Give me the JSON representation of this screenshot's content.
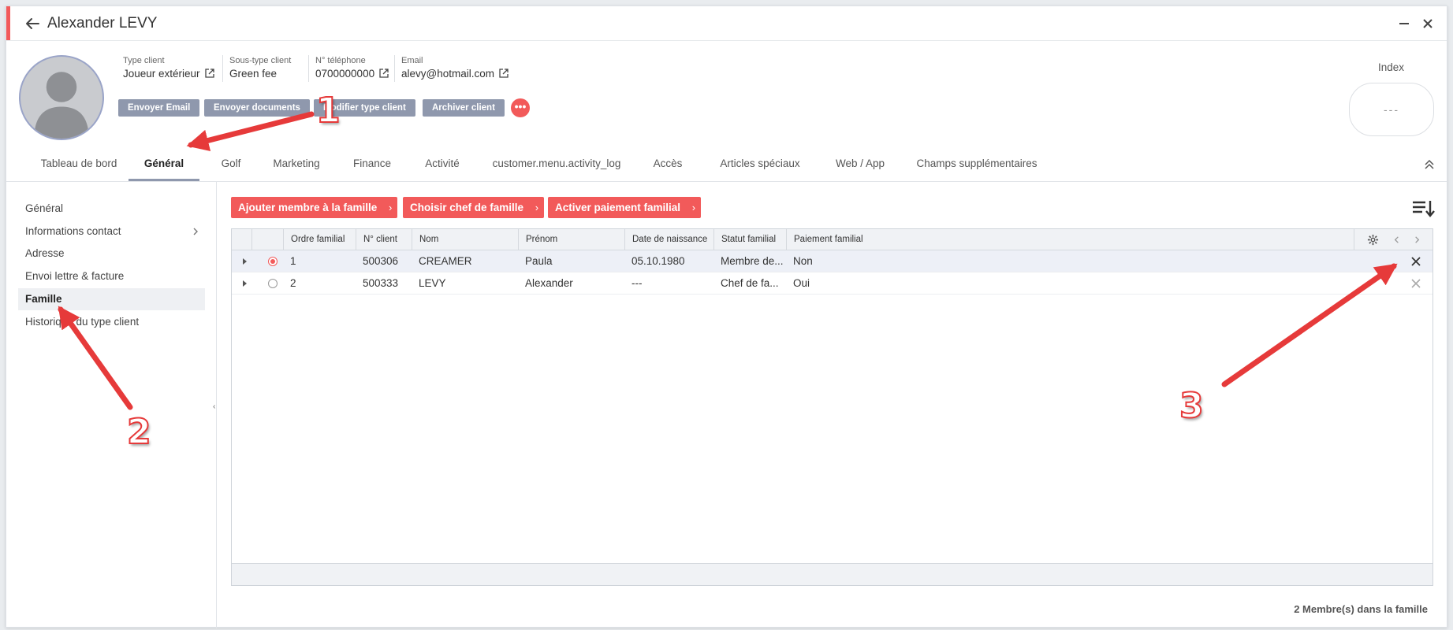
{
  "window": {
    "title": "Alexander LEVY"
  },
  "client_info": [
    {
      "label": "Type client",
      "value": "Joueur extérieur",
      "ext": true
    },
    {
      "label": "Sous-type client",
      "value": "Green fee",
      "ext": false
    },
    {
      "label": "N° téléphone",
      "value": "0700000000",
      "ext": true
    },
    {
      "label": "Email",
      "value": "alevy@hotmail.com",
      "ext": true
    }
  ],
  "actions": [
    "Envoyer Email",
    "Envoyer documents",
    "Modifier type client",
    "Archiver client"
  ],
  "more_label": "•••",
  "index": {
    "label": "Index",
    "value": "---"
  },
  "tabs": [
    "Tableau de bord",
    "Général",
    "Golf",
    "Marketing",
    "Finance",
    "Activité",
    "customer.menu.activity_log",
    "Accès",
    "Articles spéciaux",
    "Web / App",
    "Champs supplémentaires"
  ],
  "active_tab": "Général",
  "sidebar": [
    "Général",
    "Informations contact",
    "Adresse",
    "Envoi lettre & facture",
    "Famille",
    "Historique du type client"
  ],
  "active_sidebar": "Famille",
  "family_actions": [
    "Ajouter membre à la famille",
    "Choisir chef de famille",
    "Activer paiement familial"
  ],
  "grid": {
    "columns": [
      "Ordre familial",
      "N° client",
      "Nom",
      "Prénom",
      "Date de naissance",
      "Statut familial",
      "Paiement familial"
    ],
    "rows": [
      {
        "ordre": "1",
        "num": "500306",
        "nom": "CREAMER",
        "prenom": "Paula",
        "naissance": "05.10.1980",
        "statut": "Membre de...",
        "paiement": "Non",
        "selected": true
      },
      {
        "ordre": "2",
        "num": "500333",
        "nom": "LEVY",
        "prenom": "Alexander",
        "naissance": "---",
        "statut": "Chef de fa...",
        "paiement": "Oui",
        "selected": false
      }
    ]
  },
  "footer": {
    "count_text": "2 Membre(s) dans la famille"
  },
  "annotations": [
    "1",
    "2",
    "3"
  ],
  "colors": {
    "accent": "#f25a5a",
    "secondary_button": "#8f98ad",
    "annotation": "#e63a3a"
  }
}
